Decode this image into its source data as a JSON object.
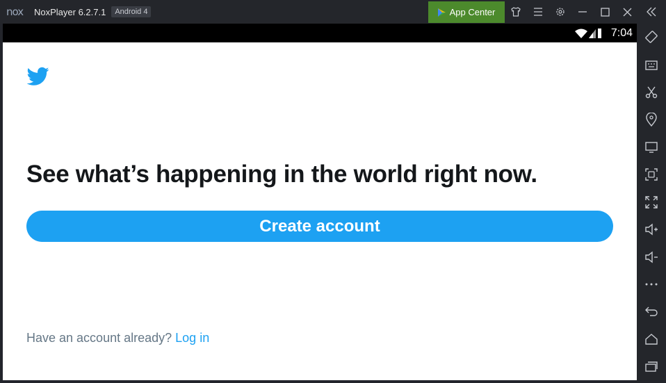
{
  "titlebar": {
    "app_name": "NoxPlayer 6.2.7.1",
    "android_badge": "Android 4",
    "app_center_label": "App Center",
    "logo_text": "nox",
    "icons": [
      "tshirt-icon",
      "menu-icon",
      "settings-icon",
      "minimize-icon",
      "maximize-icon",
      "close-icon",
      "collapse-icon"
    ]
  },
  "statusbar": {
    "time": "7:04",
    "icons": [
      "wifi-icon",
      "signal-icon",
      "battery-icon"
    ]
  },
  "twitter": {
    "headline": "See what’s happening in the world right now.",
    "create_account_label": "Create account",
    "have_account_text": "Have an account already?",
    "login_label": "Log in",
    "brand_color": "#1DA1F2"
  },
  "sidebar": {
    "icons": [
      "rotate-icon",
      "keyboard-icon",
      "scissors-icon",
      "location-icon",
      "screen-icon",
      "screenshot-icon",
      "fullscreen-icon",
      "volume-up-icon",
      "volume-down-icon",
      "more-icon",
      "back-icon",
      "home-icon",
      "recent-apps-icon"
    ]
  }
}
